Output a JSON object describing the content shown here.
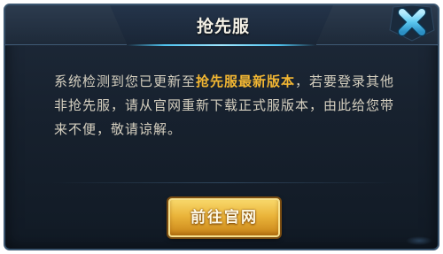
{
  "dialog": {
    "title": "抢先服",
    "close_icon": "close-x-icon",
    "message": {
      "part1": "系统检测到您已更新至",
      "highlight": "抢先服最新版本",
      "part2": "，若要登录其他非抢先服，请从官网重新下载正式服版本，由此给您带来不便，敬请谅解。"
    },
    "button_label": "前往官网"
  },
  "colors": {
    "highlight_text": "#f2b632",
    "body_text": "#d6d0c0",
    "button_gold": "#eab43a",
    "close_icon_blue": "#5cc8f0",
    "panel_bg": "#17212e"
  }
}
